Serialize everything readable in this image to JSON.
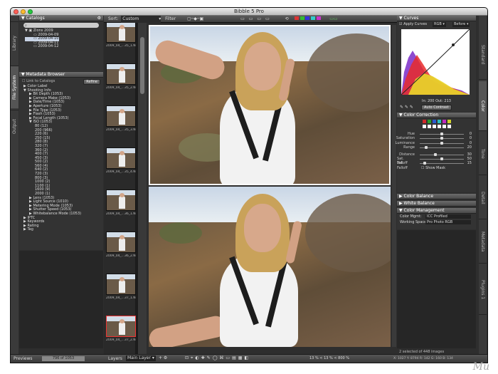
{
  "app": {
    "title": "Bibble 5 Pro"
  },
  "left_tabs": [
    "Library",
    "File System",
    "Output"
  ],
  "right_tabs": [
    "Standard",
    "Color",
    "Tone",
    "Detail",
    "Metadata",
    "Plugins 1"
  ],
  "catalogs": {
    "header": "Catalogs",
    "items": [
      "Zions 2009",
      "2009-04-09",
      "2009-04-10",
      "2009-04-11",
      "2009-04-12"
    ]
  },
  "metadata_browser": {
    "header": "Metadata Browser",
    "link_label": "Link to Catalogs",
    "refine_label": "Refine",
    "items": [
      "Color Label",
      "Shooting Info",
      "Bit Depth (1053)",
      "Camera Make (1053)",
      "Date/Time (1053)",
      "Aperture (1053)",
      "File Type (1053)",
      "Flash (1053)",
      "Focal Length (1053)",
      "ISO (1053)",
      "80 (12)",
      "200 (966)",
      "220 (6)",
      "250 (15)",
      "280 (8)",
      "320 (7)",
      "360 (2)",
      "400 (7)",
      "450 (3)",
      "500 (2)",
      "560 (4)",
      "640 (2)",
      "720 (3)",
      "800 (3)",
      "1000 (2)",
      "1100 (1)",
      "1600 (9)",
      "2000 (1)",
      "Lens (1053)",
      "Light Source (1010)",
      "Metering Mode (1053)",
      "Shutter Speed (1053)",
      "Whitebalance Mode (1053)",
      "IPTC",
      "Keywords",
      "Rating",
      "Tag"
    ]
  },
  "previews": {
    "label": "Previews",
    "count": "796 of 1053"
  },
  "toolbar": {
    "sort_label": "Sort:",
    "sort_value": "Custom",
    "filter_label": "Filter"
  },
  "thumbnails": [
    "2009_04_...35_1.NEF",
    "2009_04_...35_2.NEF",
    "2009_04_...35_3.NEF",
    "2009_04_...35_4.NEF",
    "2009_04_...36_1.NEF",
    "2009_04_...36_2.NEF",
    "2009_04_...37_1.NEF",
    "2009_04_...37_2.NEF"
  ],
  "bottom_toolbar": {
    "layers_label": "Layers",
    "layer_select": "Main Layer",
    "zoom": "13 % < 13 % < 800 %"
  },
  "status": {
    "selected": "2 selected of 448 images",
    "readout": "X: 1027  Y: 8794   R: 142  G: 160  B: 134"
  },
  "curves": {
    "header": "Curves",
    "apply_label": "Apply Curves",
    "channel": "RGB",
    "mode": "Before",
    "in_label": "In:",
    "in_value": "200",
    "out_label": "Out:",
    "out_value": "213",
    "auto_label": "Auto Contrast"
  },
  "color_correction": {
    "header": "Color Correction",
    "swatches": [
      "#d02a2a",
      "#2aa02a",
      "#2a5ad0",
      "#2ac0c0",
      "#c02ac0",
      "#d0d02a"
    ],
    "sliders": [
      {
        "label": "Hue",
        "value": "0",
        "pos": 0.5
      },
      {
        "label": "Saturation",
        "value": "0",
        "pos": 0.5
      },
      {
        "label": "Luminance",
        "value": "0",
        "pos": 0.5
      },
      {
        "label": "Range",
        "value": "20",
        "pos": 0.15
      },
      {
        "label": "Distance",
        "value": "30",
        "pos": 0.35
      },
      {
        "label": "Sat. Falloff",
        "value": "50",
        "pos": 0.5
      },
      {
        "label": "Val. Falloff",
        "value": "15",
        "pos": 0.12
      }
    ],
    "show_mask": "Show Mask"
  },
  "color_balance": {
    "header": "Color Balance"
  },
  "white_balance": {
    "header": "White Balance"
  },
  "color_management": {
    "header": "Color Management",
    "mgmt_label": "Color Mgmt:",
    "mgmt_value": "ICC Profiled",
    "space_label": "Working Space:",
    "space_value": "Pro Photo RGB"
  },
  "watermark": "Mu"
}
